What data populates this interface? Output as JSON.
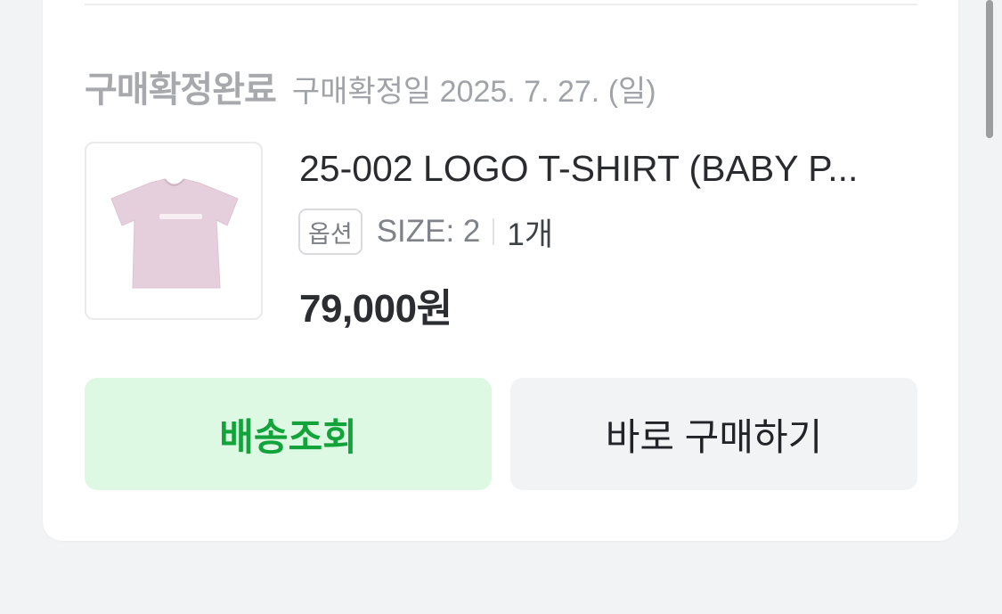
{
  "order": {
    "status": "구매확정완료",
    "confirm_date": "구매확정일 2025. 7. 27. (일)"
  },
  "product": {
    "name": "25-002 LOGO T-SHIRT (BABY P...",
    "thumbnail_icon": "tshirt-icon",
    "thumbnail_color": "#e6cfdc",
    "option_chip": "옵션",
    "size": "SIZE: 2",
    "quantity": "1개",
    "price": "79,000원"
  },
  "actions": {
    "track_label": "배송조회",
    "buy_again_label": "바로 구매하기"
  },
  "colors": {
    "track_bg": "#ddf8e3",
    "track_text": "#12a43a",
    "buy_bg": "#f2f3f5",
    "page_bg": "#f2f3f5"
  }
}
